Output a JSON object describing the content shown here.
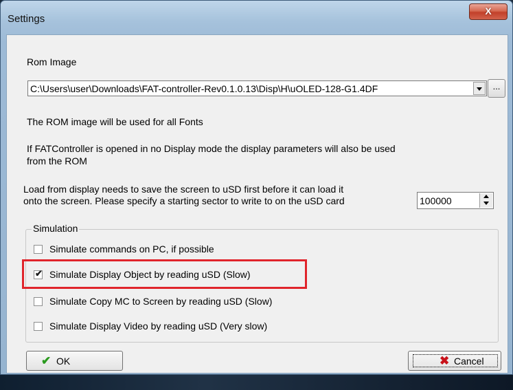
{
  "window": {
    "title": "Settings",
    "close_symbol": "X"
  },
  "rom": {
    "label": "Rom Image",
    "path": "C:\\Users\\user\\Downloads\\FAT-controller-Rev0.1.0.13\\Disp\\H\\uOLED-128-G1.4DF",
    "browse_label": "...",
    "note1": "The ROM image will be used for all Fonts",
    "note2_line1": "If FATController is opened in no Display mode the display parameters will also be used",
    "note2_line2": "from the ROM"
  },
  "sector": {
    "line1": "Load from display needs to save the screen to uSD first before it can load it",
    "line2": "onto the screen. Please specify a starting sector to write to on the uSD card",
    "value": "100000"
  },
  "simulation": {
    "legend": "Simulation",
    "options": [
      {
        "label": "Simulate commands on PC, if possible",
        "checked": false
      },
      {
        "label": "Simulate Display Object by reading uSD (Slow)",
        "checked": true
      },
      {
        "label": "Simulate Copy MC to Screen by reading uSD (Slow)",
        "checked": false
      },
      {
        "label": "Simulate Display Video by reading uSD (Very slow)",
        "checked": false
      }
    ],
    "check_mark": "✔"
  },
  "buttons": {
    "ok": "OK",
    "cancel": "Cancel",
    "ok_icon": "✔",
    "cancel_icon": "✖"
  },
  "colors": {
    "highlight": "#e0242b",
    "ok_icon": "#2a9a1e",
    "cancel_icon": "#c8121a"
  }
}
